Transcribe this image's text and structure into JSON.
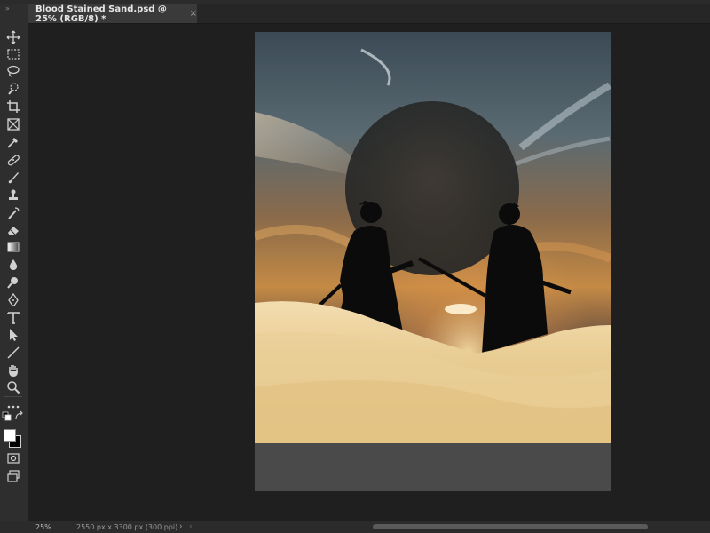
{
  "document_tab": {
    "title": "Blood Stained Sand.psd @ 25% (RGB/8) *",
    "close_glyph": "×"
  },
  "toolbar": {
    "grip": "»",
    "tools": [
      {
        "name": "move-icon"
      },
      {
        "name": "marquee-icon"
      },
      {
        "name": "lasso-icon"
      },
      {
        "name": "quick-select-icon"
      },
      {
        "name": "crop-icon"
      },
      {
        "name": "frame-icon"
      },
      {
        "name": "eyedropper-icon"
      },
      {
        "name": "healing-icon"
      },
      {
        "name": "brush-icon"
      },
      {
        "name": "clone-stamp-icon"
      },
      {
        "name": "history-brush-icon"
      },
      {
        "name": "eraser-icon"
      },
      {
        "name": "gradient-icon"
      },
      {
        "name": "blur-icon"
      },
      {
        "name": "dodge-icon"
      },
      {
        "name": "pen-icon"
      },
      {
        "name": "type-icon"
      },
      {
        "name": "path-select-icon"
      },
      {
        "name": "line-icon"
      },
      {
        "name": "hand-icon"
      },
      {
        "name": "zoom-icon"
      },
      {
        "name": "more-tools-icon"
      }
    ],
    "foreground_color": "#ffffff",
    "background_color": "#000000"
  },
  "status_bar": {
    "zoom": "25%",
    "doc_info": "2550 px x 3300 px (300 ppi)",
    "arrow": "›",
    "scroll_left": "‹"
  }
}
